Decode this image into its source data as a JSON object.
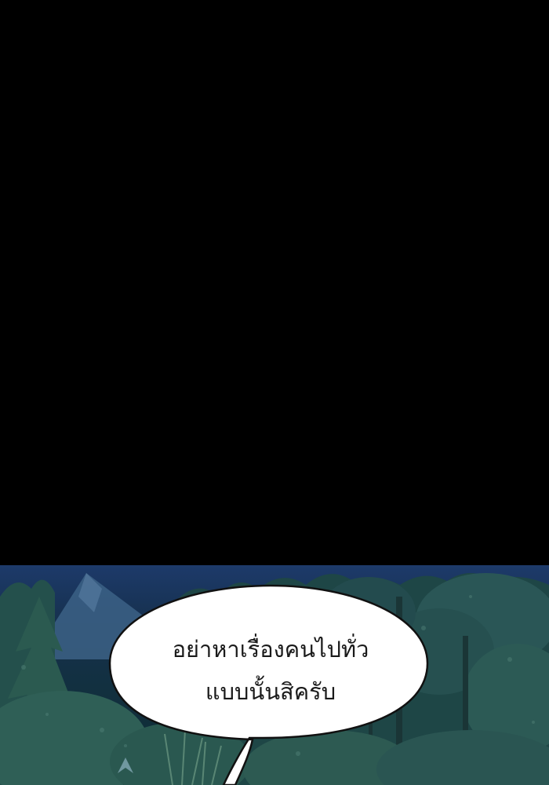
{
  "panel": {
    "top": "black",
    "bottom": "night-forest"
  },
  "speech_bubble": {
    "lines": [
      "อย่าหาเรื่องคนไปทั่ว",
      "แบบนั้นสิครับ"
    ]
  },
  "colors": {
    "sky": "#1d3a6a",
    "foliage": "#1f4a4a",
    "bubble_fill": "#ffffff",
    "bubble_outline": "#111111"
  }
}
